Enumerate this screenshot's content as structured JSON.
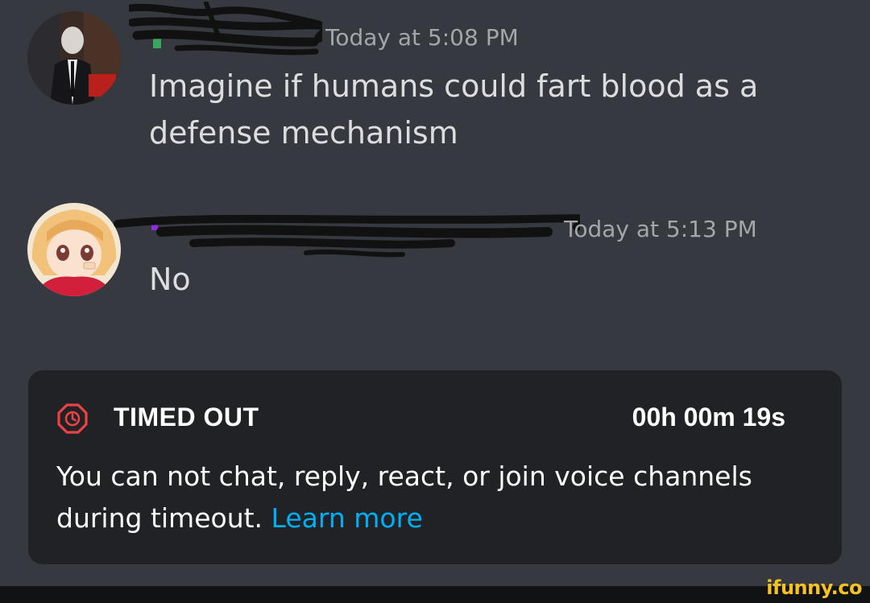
{
  "messages": [
    {
      "timestamp": "Today at 5:08 PM",
      "content": "Imagine if humans could fart blood as a defense mechanism"
    },
    {
      "timestamp": "Today at 5:13 PM",
      "content": "No"
    }
  ],
  "timeout": {
    "title": "TIMED OUT",
    "timer": "00h 00m 19s",
    "description": "You can not chat, reply, react, or join voice channels during timeout.",
    "learn_more": "Learn more",
    "icon": "stop-octagon-icon",
    "accent_color": "#ed4245"
  },
  "watermark": "ifunny.co",
  "colors": {
    "background": "#36393f",
    "timeout_bg": "#202225",
    "link": "#00aff4",
    "timestamp": "#a3a6aa"
  }
}
